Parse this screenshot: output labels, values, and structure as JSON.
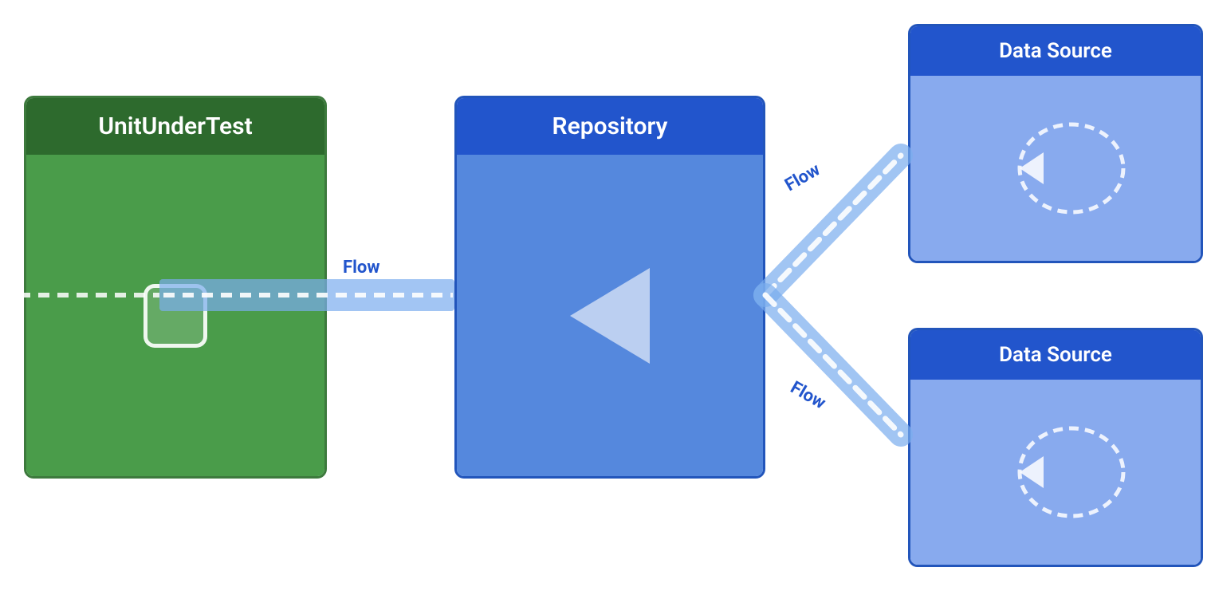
{
  "unit_under_test": {
    "header": "UnitUnderTest",
    "bg_header": "#2d6a2d",
    "bg_body": "#4a9c4a"
  },
  "repository": {
    "header": "Repository",
    "bg_header": "#2255cc",
    "bg_body": "#5588dd"
  },
  "data_sources": [
    {
      "id": "top",
      "header": "Data Source",
      "bg_header": "#2255cc",
      "bg_body": "#88aaee"
    },
    {
      "id": "bottom",
      "header": "Data Source",
      "bg_header": "#2255cc",
      "bg_body": "#88aaee"
    }
  ],
  "flow_labels": {
    "label": "Flow"
  },
  "colors": {
    "flow_line": "#7aaaee",
    "dashed_white": "#ffffff",
    "flow_text": "#2255cc"
  }
}
